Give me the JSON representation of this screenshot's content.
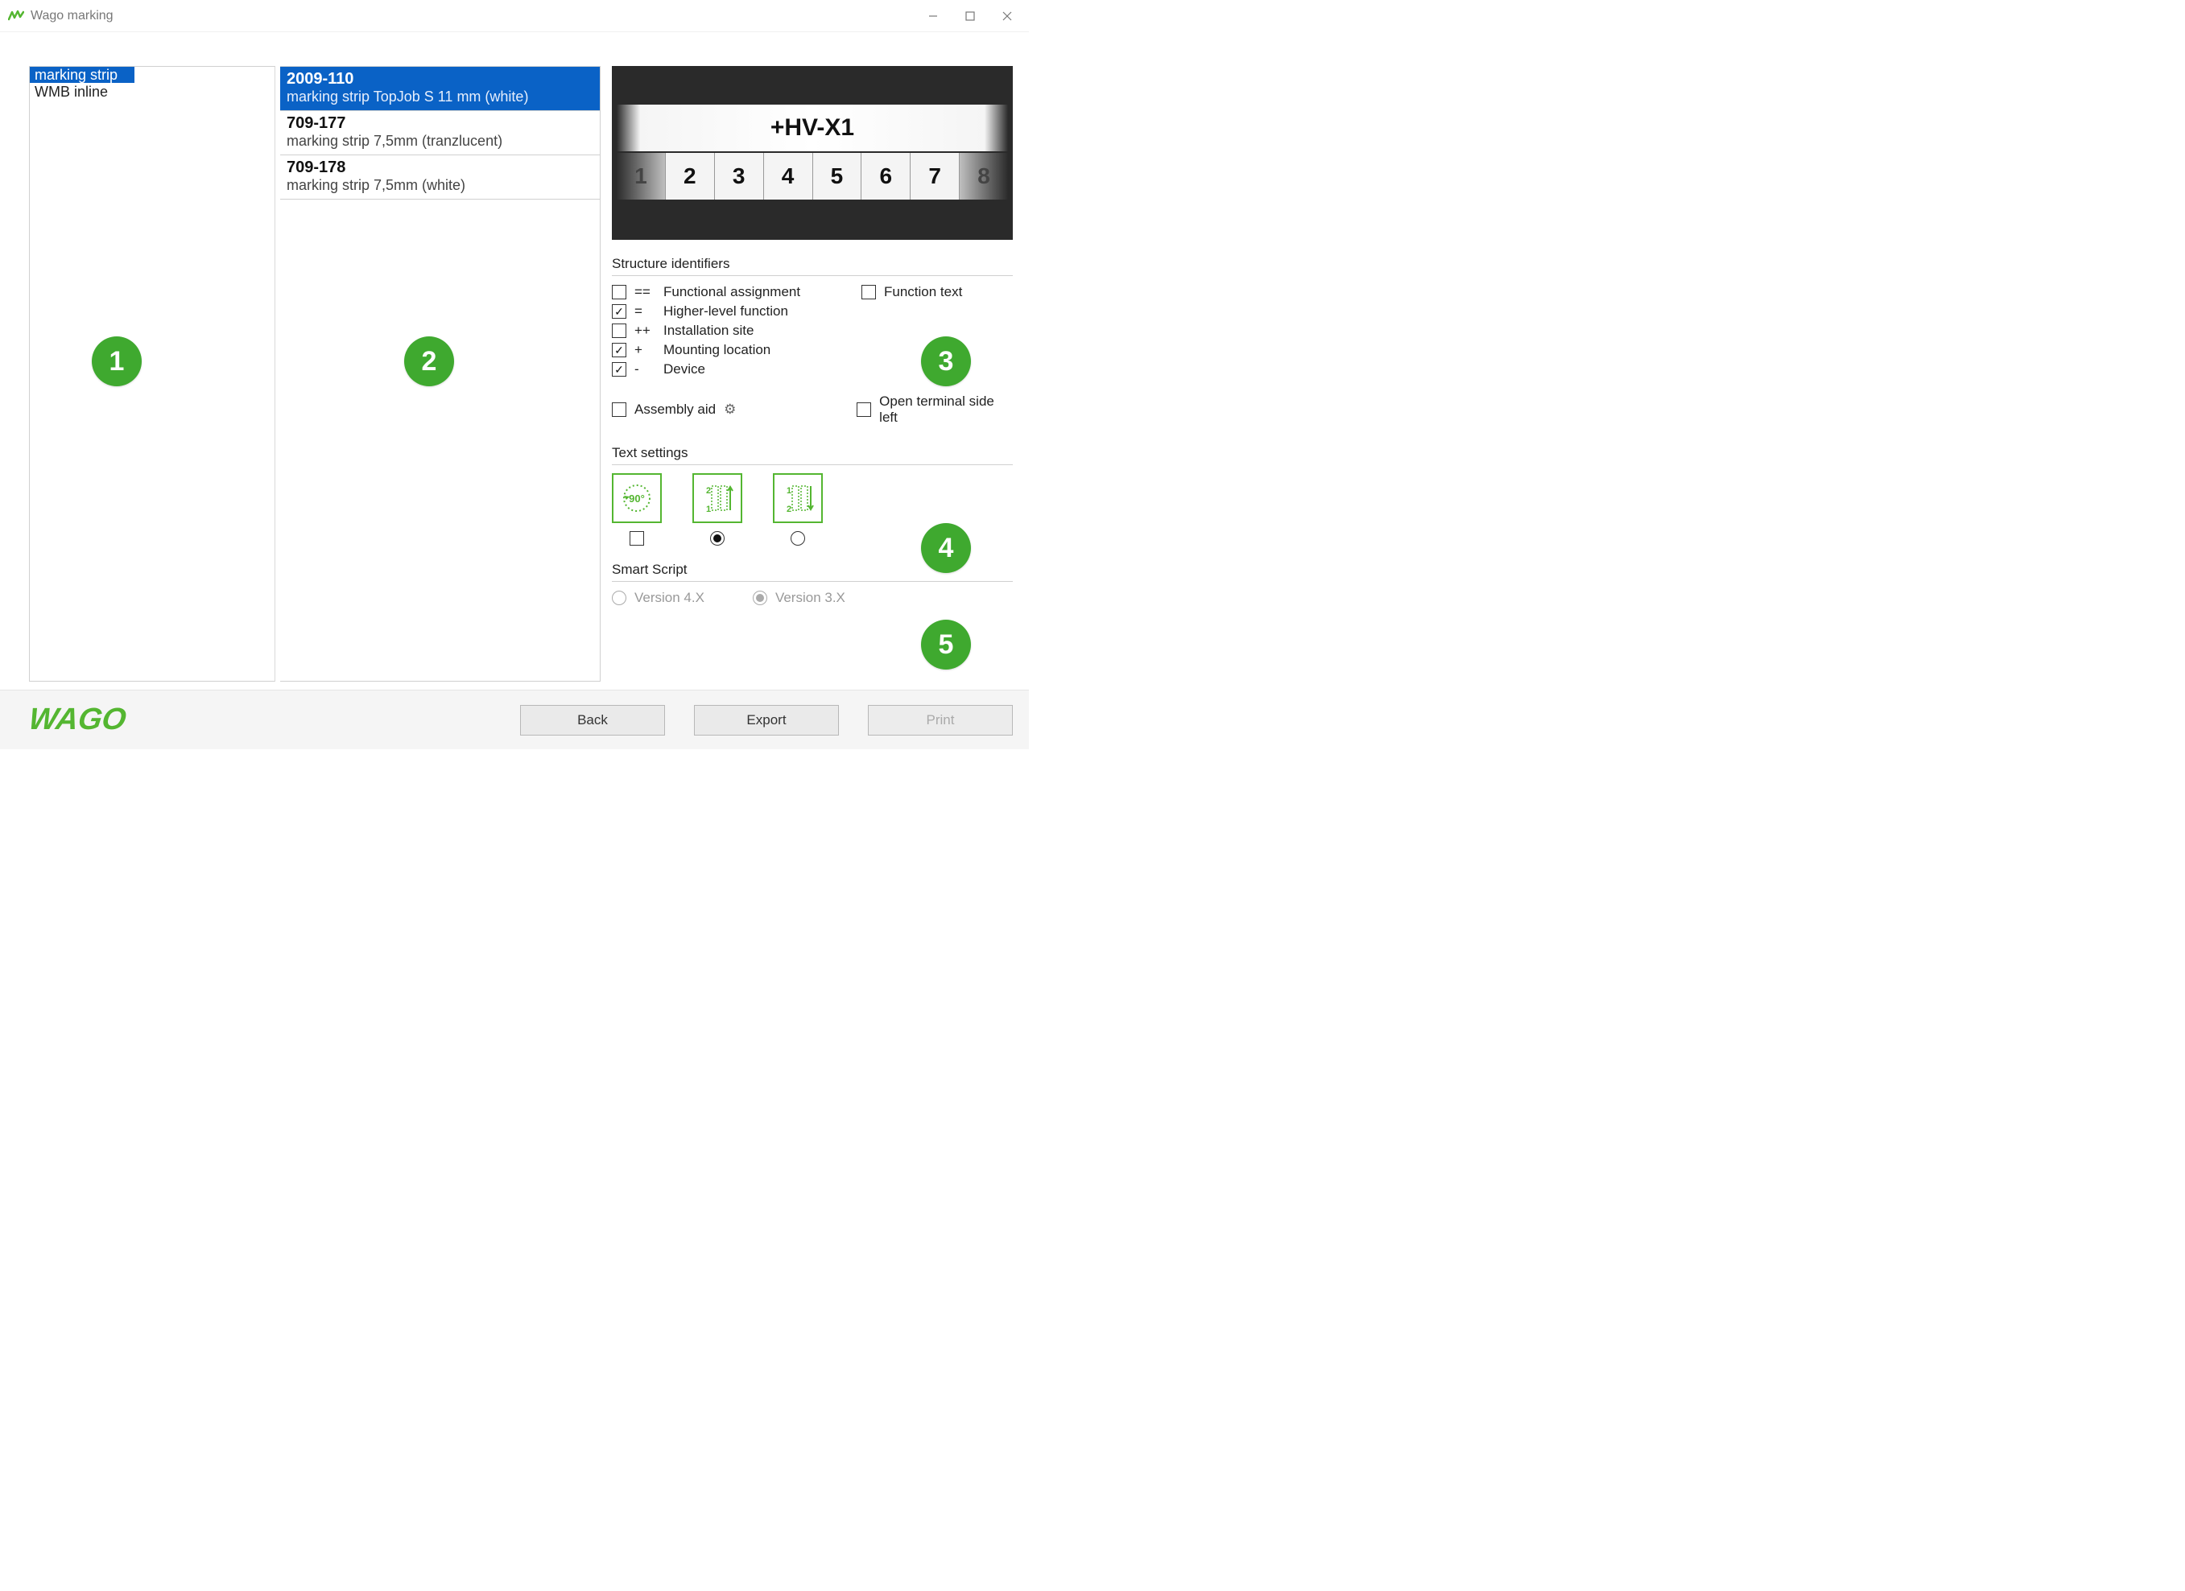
{
  "window": {
    "title": "Wago marking"
  },
  "categories": [
    {
      "label": "marking strip",
      "selected": true
    },
    {
      "label": "WMB inline",
      "selected": false
    }
  ],
  "products": [
    {
      "code": "2009-110",
      "desc": "marking strip TopJob S 11 mm (white)",
      "selected": true
    },
    {
      "code": "709-177",
      "desc": "marking strip 7,5mm (tranzlucent)",
      "selected": false
    },
    {
      "code": "709-178",
      "desc": "marking strip 7,5mm (white)",
      "selected": false
    }
  ],
  "preview": {
    "designation": "+HV-X1",
    "cells": [
      "1",
      "2",
      "3",
      "4",
      "5",
      "6",
      "7",
      "8"
    ]
  },
  "sections": {
    "structure": "Structure identifiers",
    "text": "Text settings",
    "script": "Smart Script"
  },
  "structure": {
    "left": [
      {
        "prefix": "==",
        "label": "Functional assignment",
        "checked": false
      },
      {
        "prefix": "=",
        "label": "Higher-level function",
        "checked": true
      },
      {
        "prefix": "++",
        "label": "Installation site",
        "checked": false
      },
      {
        "prefix": "+",
        "label": "Mounting location",
        "checked": true
      },
      {
        "prefix": "-",
        "label": "Device",
        "checked": true
      }
    ],
    "right": [
      {
        "label": "Function text",
        "checked": false
      }
    ],
    "assembly": {
      "label": "Assembly aid",
      "checked": false
    },
    "openTerminal": {
      "label": "Open terminal side left",
      "checked": false
    }
  },
  "textSettings": {
    "rotate90": {
      "label": "90°",
      "checked": false
    },
    "direction": [
      {
        "name": "up",
        "selected": true
      },
      {
        "name": "down",
        "selected": false
      }
    ]
  },
  "smartScript": {
    "options": [
      {
        "label": "Version 4.X",
        "selected": false
      },
      {
        "label": "Version 3.X",
        "selected": true
      }
    ]
  },
  "buttons": {
    "back": "Back",
    "export": "Export",
    "print": "Print"
  },
  "logo": "WAGO",
  "annotations": [
    "1",
    "2",
    "3",
    "4",
    "5"
  ]
}
